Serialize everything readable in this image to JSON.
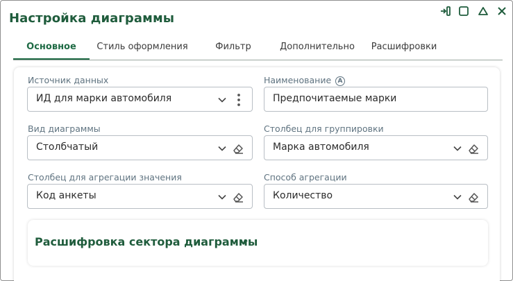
{
  "dialog": {
    "title": "Настройка диаграммы",
    "controls": [
      "pin-icon",
      "maximize-icon",
      "collapse-icon",
      "close-icon"
    ]
  },
  "tabs": [
    {
      "label": "Основное",
      "active": true
    },
    {
      "label": "Стиль оформления",
      "active": false
    },
    {
      "label": "Фильтр",
      "active": false
    },
    {
      "label": "Дополнительно",
      "active": false
    },
    {
      "label": "Расшифровки",
      "active": false
    }
  ],
  "form": {
    "data_source": {
      "label": "Источник данных",
      "value": "ИД для марки автомобиля"
    },
    "name": {
      "label": "Наименование",
      "value": "Предпочитаемые марки",
      "badge": "A"
    },
    "chart_type": {
      "label": "Вид диаграммы",
      "value": "Столбчатый"
    },
    "group_column": {
      "label": "Столбец для группировки",
      "value": "Марка автомобиля"
    },
    "agg_column": {
      "label": "Столбец для агрегации значения",
      "value": "Код анкеты"
    },
    "agg_method": {
      "label": "Способ агрегации",
      "value": "Количество"
    }
  },
  "section": {
    "title": "Расшифровка сектора диаграммы"
  },
  "colors": {
    "accent": "#1f6b45",
    "title": "#1f5c3c",
    "label": "#5f7380"
  }
}
